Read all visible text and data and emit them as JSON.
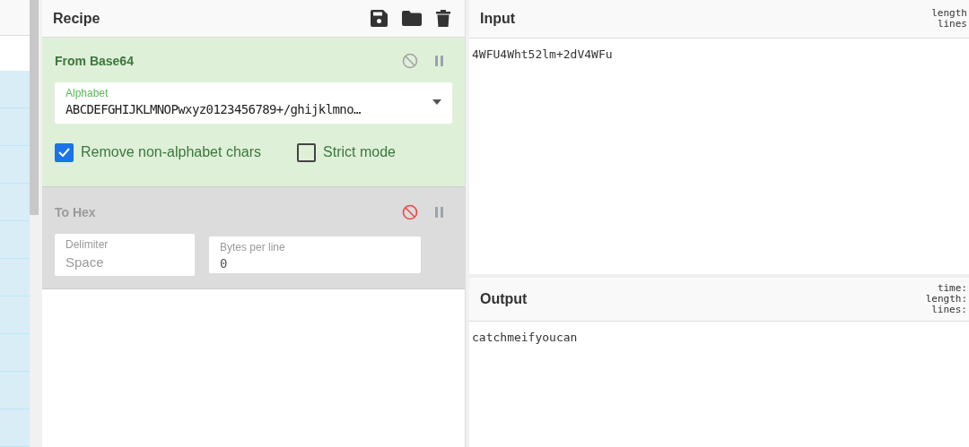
{
  "recipe": {
    "title": "Recipe",
    "operations": [
      {
        "name": "From Base64",
        "disabled": false,
        "ingredients": [
          {
            "kind": "dropdown",
            "label": "Alphabet",
            "value": "ABCDEFGHIJKLMNOPwxyz0123456789+/ghijklmno…"
          },
          {
            "kind": "checkbox",
            "label": "Remove non-alphabet chars",
            "checked": true
          },
          {
            "kind": "checkbox",
            "label": "Strict mode",
            "checked": false
          }
        ]
      },
      {
        "name": "To Hex",
        "disabled": true,
        "ingredients": [
          {
            "kind": "text",
            "label": "Delimiter",
            "value": "Space"
          },
          {
            "kind": "number",
            "label": "Bytes per line",
            "value": "0"
          }
        ]
      }
    ]
  },
  "input": {
    "title": "Input",
    "value": "4WFU4Wht52lm+2dV4WFu",
    "stats": [
      "length",
      "lines"
    ]
  },
  "output": {
    "title": "Output",
    "value": "catchmeifyoucan",
    "stats": [
      "time:",
      "length:",
      "lines:"
    ]
  }
}
